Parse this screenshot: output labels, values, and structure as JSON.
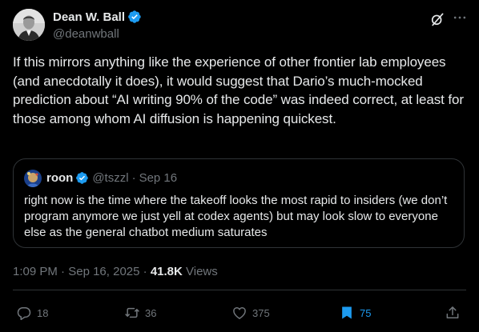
{
  "author": {
    "name": "Dean W. Ball",
    "handle": "@deanwball"
  },
  "icons": {
    "verified": "verified-badge-icon",
    "grok": "grok-icon",
    "more": "more-icon"
  },
  "post": {
    "text": "If this mirrors anything like the experience of other frontier lab employees (and anecdotally it does), it would suggest that Dario’s much-mocked prediction about “AI writing 90% of the code” was indeed correct, at least for those among whom AI diffusion is happening quickest."
  },
  "quote": {
    "name": "roon",
    "handle": "@tszzl",
    "separator": "·",
    "date": "Sep 16",
    "text": "right now is the time where the takeoff looks the most rapid to insiders (we don’t program anymore we just yell at codex agents) but may look slow to everyone else as the general chatbot medium saturates"
  },
  "meta": {
    "time": "1:09 PM",
    "sep1": "·",
    "date": "Sep 16, 2025",
    "sep2": "·",
    "views_count": "41.8K",
    "views_label": "Views"
  },
  "actions": {
    "replies": "18",
    "reposts": "36",
    "likes": "375",
    "bookmarks": "75"
  },
  "colors": {
    "background": "#000000",
    "text": "#e7e9ea",
    "muted": "#71767b",
    "accent": "#1d9bf0",
    "border": "#2f3336"
  }
}
